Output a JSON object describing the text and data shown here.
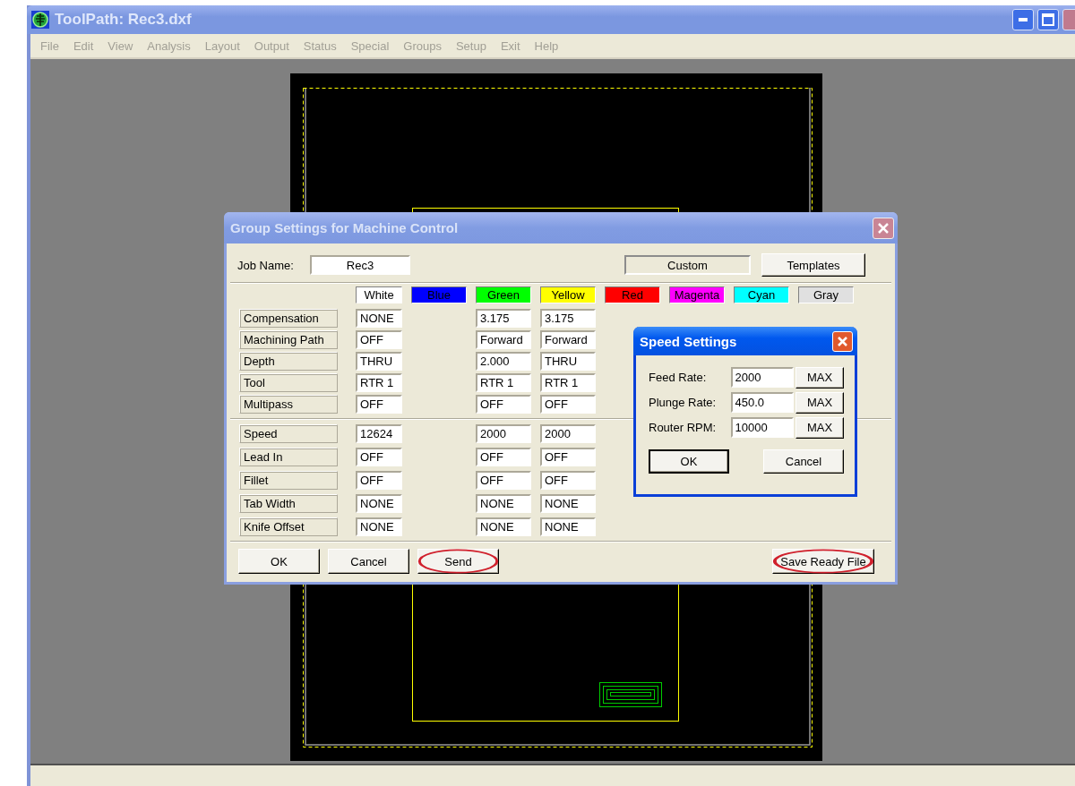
{
  "window": {
    "title": "ToolPath: Rec3.dxf"
  },
  "menu": [
    {
      "label": "File",
      "disabled": true
    },
    {
      "label": "Edit",
      "disabled": true
    },
    {
      "label": "View",
      "disabled": true
    },
    {
      "label": "Analysis",
      "disabled": true
    },
    {
      "label": "Layout",
      "disabled": true
    },
    {
      "label": "Output",
      "disabled": true
    },
    {
      "label": "Status",
      "disabled": true
    },
    {
      "label": "Special",
      "disabled": true
    },
    {
      "label": "Groups",
      "disabled": true
    },
    {
      "label": "Setup",
      "disabled": true
    },
    {
      "label": "Exit",
      "disabled": true
    },
    {
      "label": "Help",
      "disabled": true
    }
  ],
  "group_dialog": {
    "title": "Group Settings for Machine Control",
    "job_name_label": "Job Name:",
    "job_name": "Rec3",
    "template_name": "Custom",
    "templates_button": "Templates",
    "columns": [
      {
        "label": "White",
        "color": "#ffffff",
        "kind": "filled"
      },
      {
        "label": "Blue",
        "color": "#0000ff",
        "kind": "empty"
      },
      {
        "label": "Green",
        "color": "#00ff00",
        "kind": "filled"
      },
      {
        "label": "Yellow",
        "color": "#ffff00",
        "kind": "filled"
      },
      {
        "label": "Red",
        "color": "#ff0000",
        "kind": "empty"
      },
      {
        "label": "Magenta",
        "color": "#ff00ff",
        "kind": "empty"
      },
      {
        "label": "Cyan",
        "color": "#00ffff",
        "kind": "empty"
      },
      {
        "label": "Gray",
        "color": "#e0e0e0",
        "kind": "empty"
      }
    ],
    "row_groups": [
      [
        {
          "label": "Compensation",
          "values": [
            "NONE",
            "3.175",
            "3.175"
          ]
        },
        {
          "label": "Machining Path",
          "values": [
            "OFF",
            "Forward",
            "Forward"
          ]
        },
        {
          "label": "Depth",
          "values": [
            "THRU",
            "2.000",
            "THRU"
          ]
        },
        {
          "label": "Tool",
          "values": [
            "RTR 1",
            "RTR 1",
            "RTR 1"
          ]
        },
        {
          "label": "Multipass",
          "values": [
            "OFF",
            "OFF",
            "OFF"
          ]
        }
      ],
      [
        {
          "label": "Speed",
          "values": [
            "12624",
            "2000",
            "2000"
          ]
        },
        {
          "label": "Lead In",
          "values": [
            "OFF",
            "OFF",
            "OFF"
          ]
        },
        {
          "label": "Fillet",
          "values": [
            "OFF",
            "OFF",
            "OFF"
          ]
        },
        {
          "label": "Tab Width",
          "values": [
            "NONE",
            "NONE",
            "NONE"
          ]
        },
        {
          "label": "Knife Offset",
          "values": [
            "NONE",
            "NONE",
            "NONE"
          ]
        }
      ]
    ],
    "buttons": [
      {
        "label": "OK",
        "kind": "main",
        "circled": false
      },
      {
        "label": "Cancel",
        "kind": "main",
        "circled": false
      },
      {
        "label": "Send",
        "kind": "main",
        "circled": true
      },
      {
        "label": "Save Ready File",
        "kind": "extra",
        "circled": true
      }
    ]
  },
  "speed_dialog": {
    "title": "Speed Settings",
    "fields": [
      {
        "label": "Feed Rate:",
        "value": "2000",
        "button": "MAX"
      },
      {
        "label": "Plunge Rate:",
        "value": "450.0",
        "button": "MAX"
      },
      {
        "label": "Router RPM:",
        "value": "10000",
        "button": "MAX"
      }
    ],
    "buttons": [
      {
        "label": "OK",
        "default": true
      },
      {
        "label": "Cancel",
        "default": false
      }
    ]
  }
}
